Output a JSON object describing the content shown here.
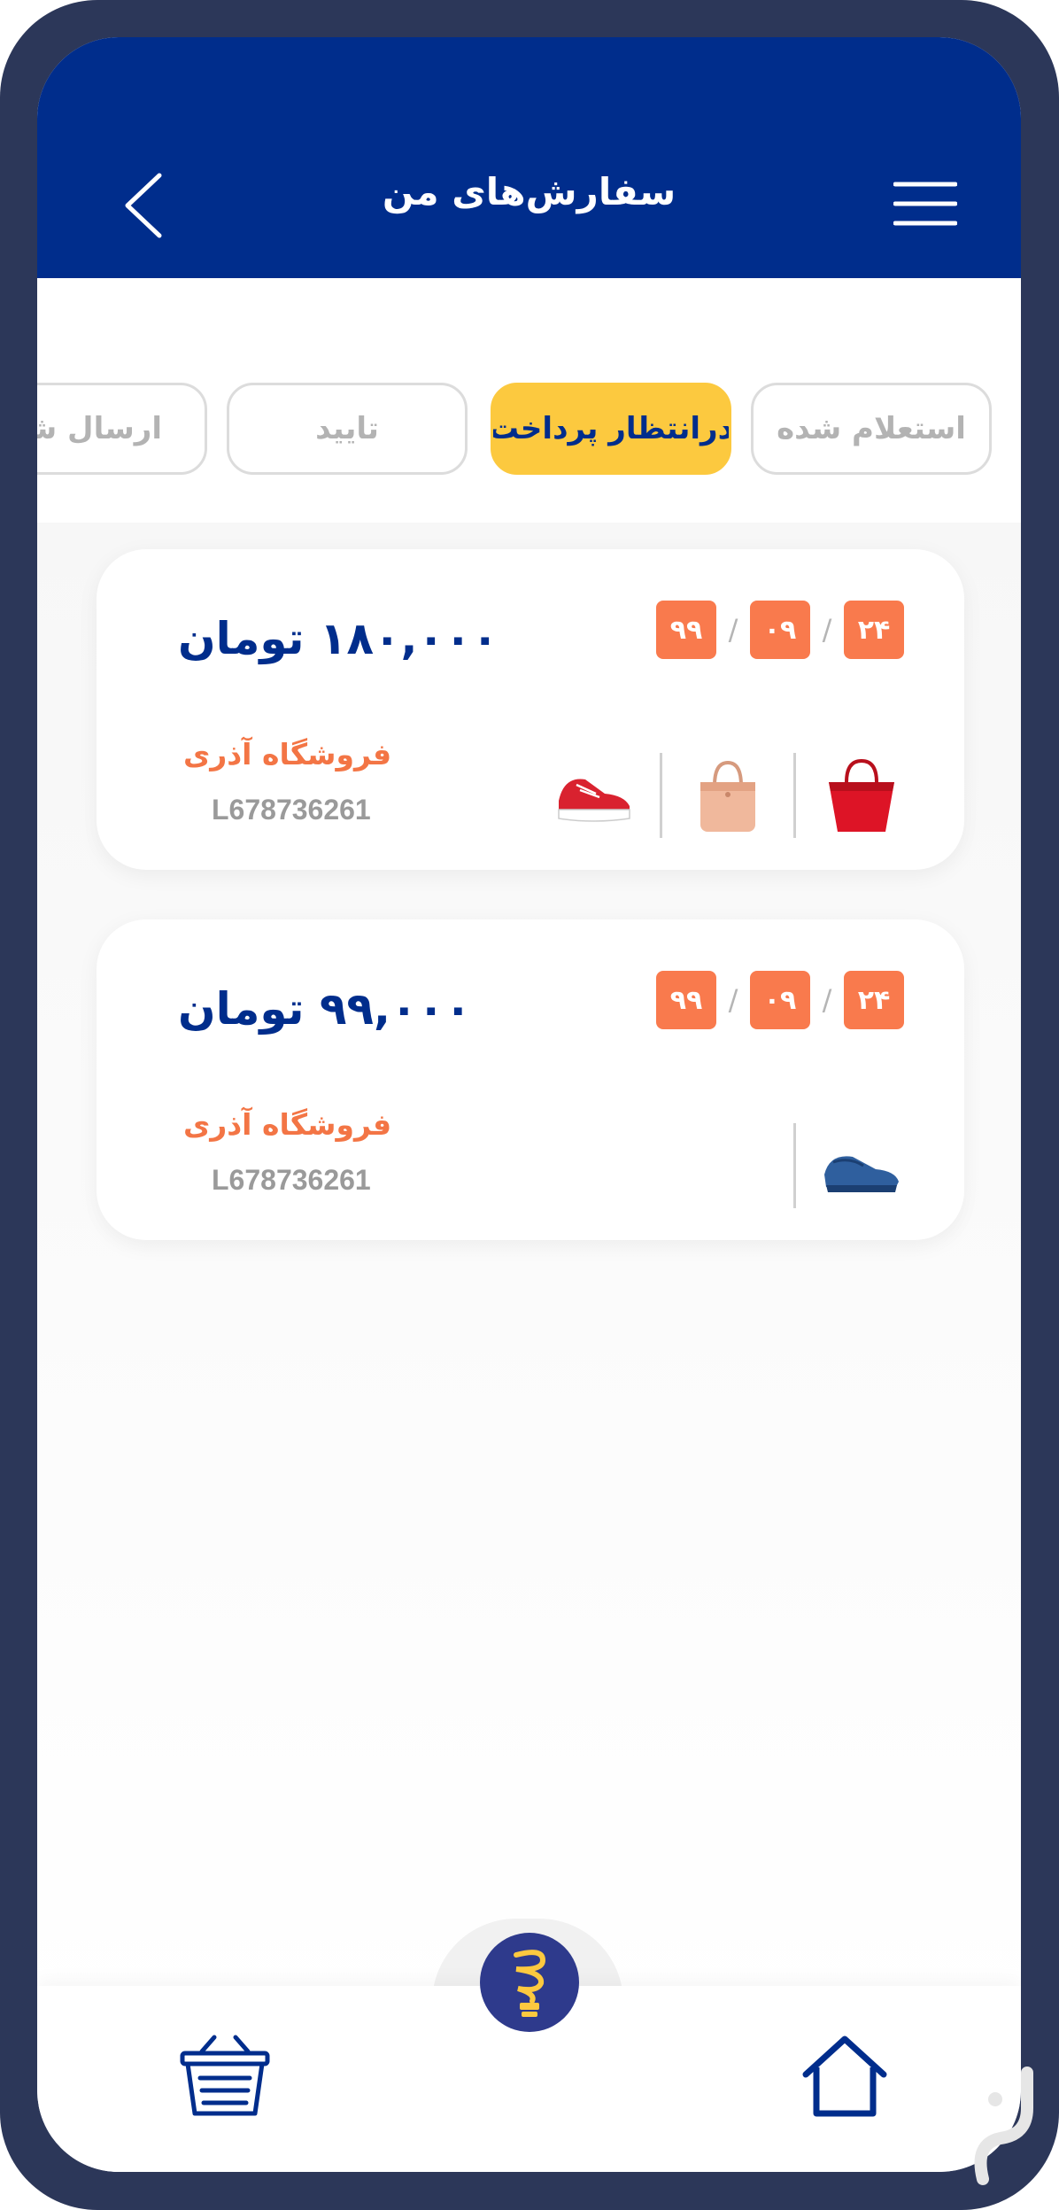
{
  "header": {
    "title": "سفارش‌های من",
    "back_icon": "chevron-left-icon",
    "menu_icon": "hamburger-menu-icon"
  },
  "tabs": [
    {
      "label": "استعلام شده",
      "active": false
    },
    {
      "label": "درانتظار پرداخت",
      "active": true
    },
    {
      "label": "تایید",
      "active": false
    },
    {
      "label": "ارسال شده",
      "active": false
    }
  ],
  "orders": [
    {
      "price": "۱۸۰,۰۰۰ تومان",
      "date": {
        "day": "۲۴",
        "month": "۰۹",
        "year": "۹۹"
      },
      "store": "فروشگاه آذری",
      "code": "L678736261",
      "products": [
        "red-handbag",
        "pink-handbag",
        "red-sneakers"
      ]
    },
    {
      "price": "۹۹,۰۰۰ تومان",
      "date": {
        "day": "۲۴",
        "month": "۰۹",
        "year": "۹۹"
      },
      "store": "فروشگاه آذری",
      "code": "L678736261",
      "products": [
        "blue-shoes"
      ]
    }
  ],
  "bottom_nav": {
    "left_icon": "basket-icon",
    "center_icon": "lightbulb-logo-icon",
    "right_icon": "home-icon"
  },
  "colors": {
    "brand_blue": "#002d8c",
    "accent_yellow": "#fcc93f",
    "orange": "#f97a4d",
    "frame": "#2c3759"
  }
}
